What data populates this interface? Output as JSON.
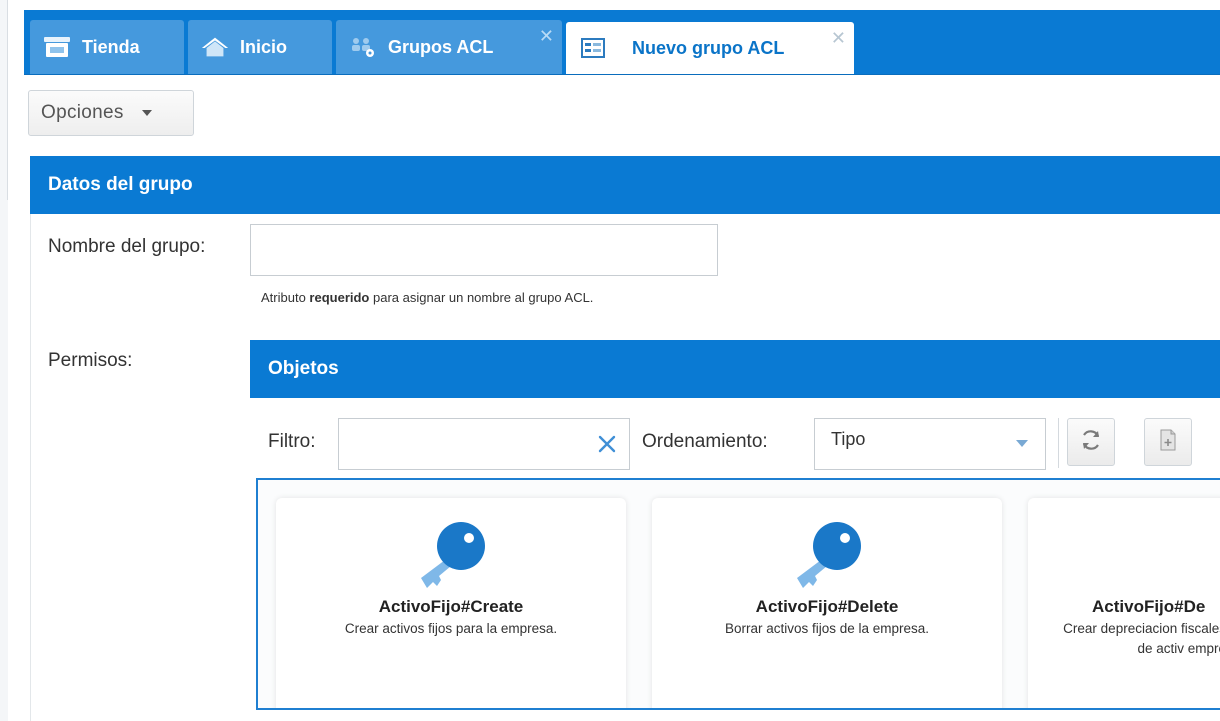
{
  "tabs": [
    {
      "label": "Tienda",
      "icon": "store-icon",
      "active": false,
      "closable": false
    },
    {
      "label": "Inicio",
      "icon": "home-icon",
      "active": false,
      "closable": false
    },
    {
      "label": "Grupos ACL",
      "icon": "users-group-icon",
      "active": false,
      "closable": true
    },
    {
      "label": "Nuevo grupo ACL",
      "icon": "form-icon",
      "active": true,
      "closable": true
    }
  ],
  "toolbar": {
    "options_label": "Opciones"
  },
  "group_panel": {
    "title": "Datos del grupo",
    "name_label": "Nombre del grupo:",
    "name_value": "",
    "hint_prefix": "Atributo ",
    "hint_bold": "requerido",
    "hint_suffix": " para asignar un nombre al grupo ACL.",
    "permissions_label": "Permisos:"
  },
  "objects_panel": {
    "title": "Objetos",
    "filter_label": "Filtro:",
    "filter_value": "",
    "sort_label": "Ordenamiento:",
    "sort_value": "Tipo",
    "cards": [
      {
        "title": "ActivoFijo#Create",
        "description": "Crear activos fijos para la empresa."
      },
      {
        "title": "ActivoFijo#Delete",
        "description": "Borrar activos fijos de la empresa."
      },
      {
        "title": "ActivoFijo#De",
        "description": "Crear depreciacion fiscales de activ empre"
      }
    ]
  },
  "colors": {
    "primary": "#0a7ad3",
    "tab_inactive": "#4599dd",
    "key": "#1a78c8",
    "key_light": "#7fb8e8"
  }
}
